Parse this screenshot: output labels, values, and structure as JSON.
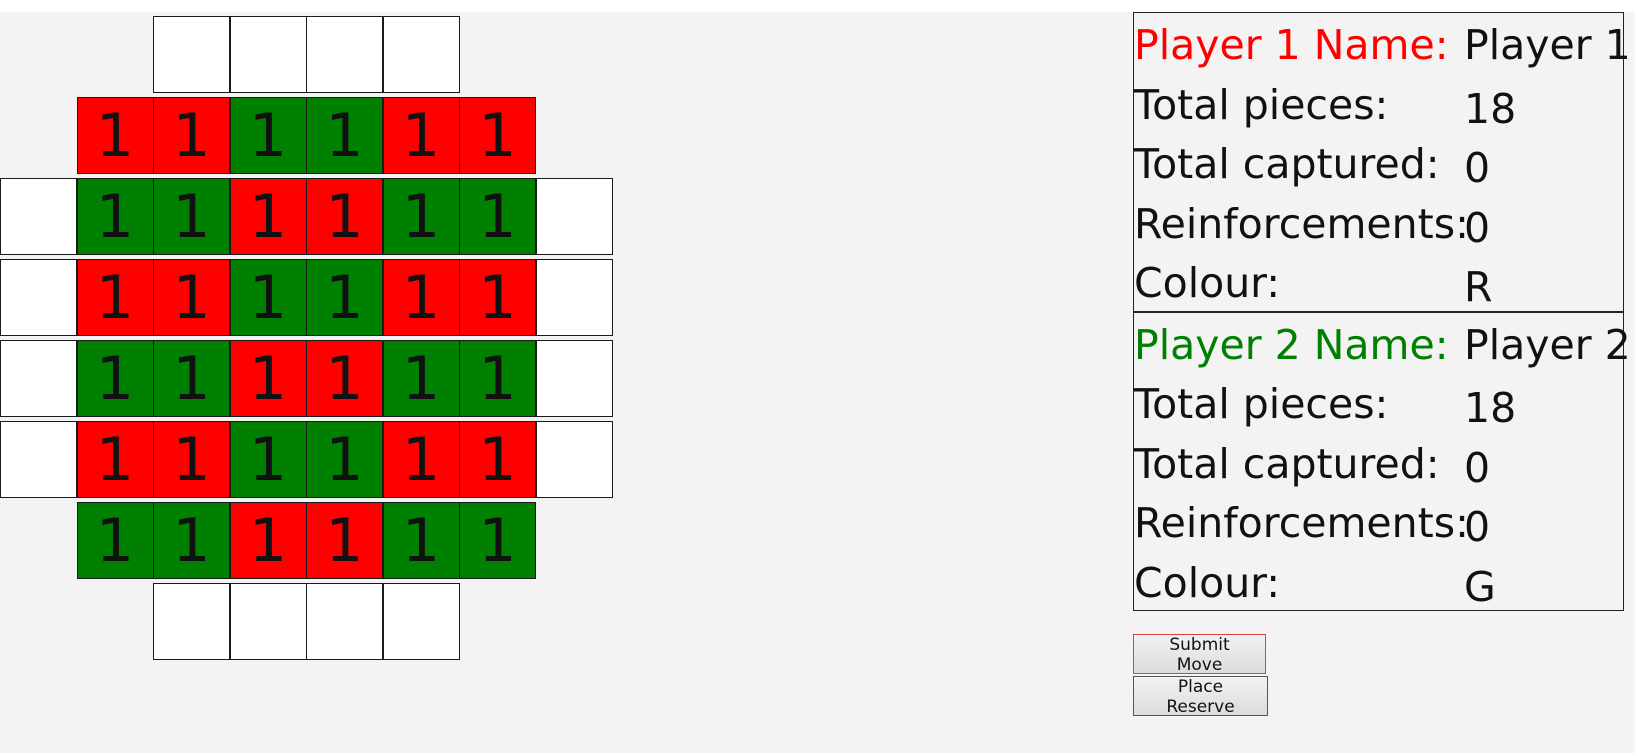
{
  "board": {
    "rows": [
      {
        "start": 2,
        "cells": [
          {
            "c": "W",
            "v": ""
          },
          {
            "c": "W",
            "v": ""
          },
          {
            "c": "W",
            "v": ""
          },
          {
            "c": "W",
            "v": ""
          }
        ]
      },
      {
        "start": 1,
        "cells": [
          {
            "c": "R",
            "v": "1"
          },
          {
            "c": "R",
            "v": "1"
          },
          {
            "c": "G",
            "v": "1"
          },
          {
            "c": "G",
            "v": "1"
          },
          {
            "c": "R",
            "v": "1"
          },
          {
            "c": "R",
            "v": "1"
          }
        ]
      },
      {
        "start": 0,
        "cells": [
          {
            "c": "W",
            "v": ""
          },
          {
            "c": "G",
            "v": "1"
          },
          {
            "c": "G",
            "v": "1"
          },
          {
            "c": "R",
            "v": "1"
          },
          {
            "c": "R",
            "v": "1"
          },
          {
            "c": "G",
            "v": "1"
          },
          {
            "c": "G",
            "v": "1"
          },
          {
            "c": "W",
            "v": ""
          }
        ]
      },
      {
        "start": 0,
        "cells": [
          {
            "c": "W",
            "v": ""
          },
          {
            "c": "R",
            "v": "1"
          },
          {
            "c": "R",
            "v": "1"
          },
          {
            "c": "G",
            "v": "1"
          },
          {
            "c": "G",
            "v": "1"
          },
          {
            "c": "R",
            "v": "1"
          },
          {
            "c": "R",
            "v": "1"
          },
          {
            "c": "W",
            "v": ""
          }
        ]
      },
      {
        "start": 0,
        "cells": [
          {
            "c": "W",
            "v": ""
          },
          {
            "c": "G",
            "v": "1"
          },
          {
            "c": "G",
            "v": "1"
          },
          {
            "c": "R",
            "v": "1"
          },
          {
            "c": "R",
            "v": "1"
          },
          {
            "c": "G",
            "v": "1"
          },
          {
            "c": "G",
            "v": "1"
          },
          {
            "c": "W",
            "v": ""
          }
        ]
      },
      {
        "start": 0,
        "cells": [
          {
            "c": "W",
            "v": ""
          },
          {
            "c": "R",
            "v": "1"
          },
          {
            "c": "R",
            "v": "1"
          },
          {
            "c": "G",
            "v": "1"
          },
          {
            "c": "G",
            "v": "1"
          },
          {
            "c": "R",
            "v": "1"
          },
          {
            "c": "R",
            "v": "1"
          },
          {
            "c": "W",
            "v": ""
          }
        ]
      },
      {
        "start": 1,
        "cells": [
          {
            "c": "G",
            "v": "1"
          },
          {
            "c": "G",
            "v": "1"
          },
          {
            "c": "R",
            "v": "1"
          },
          {
            "c": "R",
            "v": "1"
          },
          {
            "c": "G",
            "v": "1"
          },
          {
            "c": "G",
            "v": "1"
          }
        ]
      },
      {
        "start": 2,
        "cells": [
          {
            "c": "W",
            "v": ""
          },
          {
            "c": "W",
            "v": ""
          },
          {
            "c": "W",
            "v": ""
          },
          {
            "c": "W",
            "v": ""
          }
        ]
      }
    ]
  },
  "colors": {
    "red": "#ff0000",
    "green": "#008000",
    "empty": "#ffffff",
    "player1_label": "#ff0000",
    "player2_label": "#008000"
  },
  "players": [
    {
      "name_label": "Player 1 Name:",
      "name": "Player 1",
      "pieces_label": "Total pieces:",
      "pieces": "18",
      "captured_label": "Total captured:",
      "captured": "0",
      "reinforcements_label": "Reinforcements:",
      "reinforcements": "0",
      "colour_label": "Colour:",
      "colour": "R"
    },
    {
      "name_label": "Player 2 Name:",
      "name": "Player 2",
      "pieces_label": "Total pieces:",
      "pieces": "18",
      "captured_label": "Total captured:",
      "captured": "0",
      "reinforcements_label": "Reinforcements:",
      "reinforcements": "0",
      "colour_label": "Colour:",
      "colour": "G"
    }
  ],
  "buttons": {
    "submit_move": "Submit Move",
    "place_reserve": "Place Reserve"
  }
}
